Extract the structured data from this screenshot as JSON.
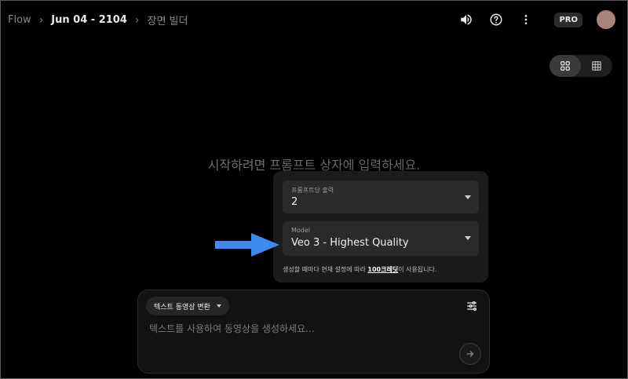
{
  "breadcrumb": {
    "items": [
      "Flow",
      "Jun 04 - 2104",
      "장면 빌더"
    ]
  },
  "header": {
    "icons": [
      "volume-icon",
      "help-icon",
      "more-vert-icon"
    ],
    "pro_badge": "PRO"
  },
  "view_toggle": {
    "options": [
      "grid-view-icon",
      "table-view-icon"
    ],
    "active": "grid-view-icon"
  },
  "main": {
    "hint": "시작하려면 프롬프트 상자에 입력하세요."
  },
  "settings": {
    "outputs_label": "프롬프트당 출력",
    "outputs_value": "2",
    "model_label": "Model",
    "model_value": "Veo 3 - Highest Quality",
    "note_prefix": "생성할 때마다 현재 설정에 따라 ",
    "note_credits": "100크레딧",
    "note_suffix": "이 사용됩니다."
  },
  "prompt": {
    "mode": "텍스트 동영상 변환",
    "placeholder": "텍스트를 사용하여 동영상을 생성하세요..."
  },
  "colors": {
    "background": "#000000",
    "annotation_arrow": "#3d8bf0"
  }
}
